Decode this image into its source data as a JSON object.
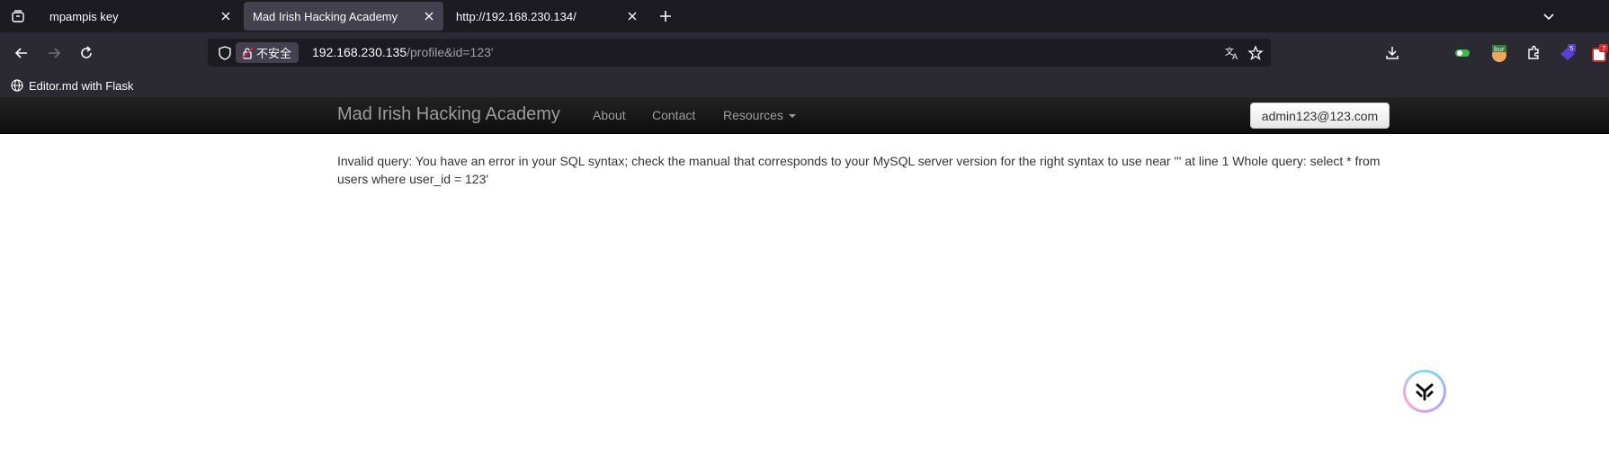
{
  "browser": {
    "tabs": [
      {
        "title": "mpampis key",
        "active": false
      },
      {
        "title": "Mad Irish Hacking Academy",
        "active": true
      },
      {
        "title": "http://192.168.230.134/",
        "active": false
      }
    ],
    "address": {
      "insecure_label": "不安全",
      "host": "192.168.230.135",
      "path": "/profile&id=123'"
    },
    "bookmarks": [
      {
        "label": "Editor.md with Flask"
      }
    ],
    "extensions": {
      "badge_5": "5",
      "badge_7": "7"
    }
  },
  "site": {
    "brand": "Mad Irish Hacking Academy",
    "nav": {
      "about": "About",
      "contact": "Contact",
      "resources": "Resources"
    },
    "user_email": "admin123@123.com"
  },
  "content": {
    "error_text": "Invalid query: You have an error in your SQL syntax; check the manual that corresponds to your MySQL server version for the right syntax to use near ''' at line 1 Whole query: select * from users where user_id = 123'"
  },
  "colors": {
    "tab_bg": "#1c1b22",
    "toolbar_bg": "#2b2a33",
    "active_tab": "#42414d",
    "site_nav": "#1b1b1b"
  }
}
